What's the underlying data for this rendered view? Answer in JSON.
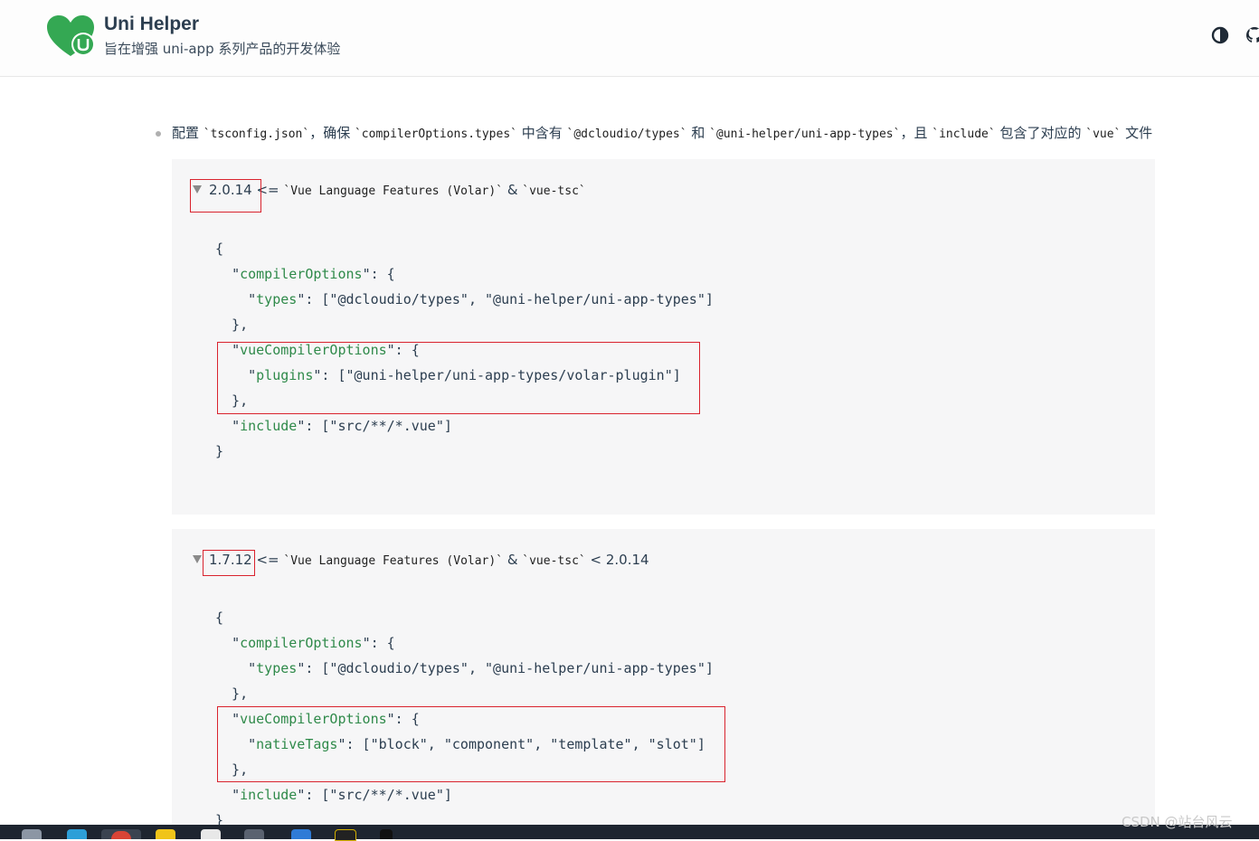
{
  "header": {
    "title": "Uni Helper",
    "subtitle": "旨在增强 uni-app 系列产品的开发体验",
    "logo_icon": "uni-helper-heart-logo-icon",
    "theme_icon": "contrast-half-circle-icon",
    "github_icon": "github-icon",
    "accent": "#34a853"
  },
  "bullet": {
    "t1": "配置 ",
    "c1": "`tsconfig.json`",
    "t2": "，确保 ",
    "c2": "`compilerOptions.types`",
    "t3": " 中含有 ",
    "c3": "`@dcloudio/types`",
    "t4": " 和 ",
    "c4": "`@uni-helper/uni-app-types`",
    "t5": "，且 ",
    "c5": "`include`",
    "t6": " 包含了对应的 ",
    "c6": "`vue`",
    "t7": " 文件"
  },
  "section1": {
    "version": "2.0.14",
    "op": " <= ",
    "tool1": "`Vue Language Features (Volar)`",
    "amp": " & ",
    "tool2": "`vue-tsc`",
    "suffix": "",
    "lines": [
      "{",
      "  \"compilerOptions\": {",
      "    \"types\": [\"@dcloudio/types\", \"@uni-helper/uni-app-types\"]",
      "  },",
      "  \"vueCompilerOptions\": {",
      "    \"plugins\": [\"@uni-helper/uni-app-types/volar-plugin\"]",
      "  },",
      "  \"include\": [\"src/**/*.vue\"]",
      "}"
    ]
  },
  "section2": {
    "version": "1.7.12",
    "op": " <= ",
    "tool1": "`Vue Language Features (Volar)`",
    "amp": " & ",
    "tool2": "`vue-tsc`",
    "suffix": " < 2.0.14",
    "lines": [
      "{",
      "  \"compilerOptions\": {",
      "    \"types\": [\"@dcloudio/types\", \"@uni-helper/uni-app-types\"]",
      "  },",
      "  \"vueCompilerOptions\": {",
      "    \"nativeTags\": [\"block\", \"component\", \"template\", \"slot\"]",
      "  },",
      "  \"include\": [\"src/**/*.vue\"]",
      "}"
    ]
  },
  "watermark": "CSDN @站台风云",
  "taskbar_icons": [
    "file-explorer-icon",
    "edge-browser-icon",
    "chrome-icon",
    "chrome-canary-icon",
    "app-icon",
    "terminal-icon",
    "vscode-icon",
    "dev-tool-icon",
    "tiktok-icon"
  ]
}
